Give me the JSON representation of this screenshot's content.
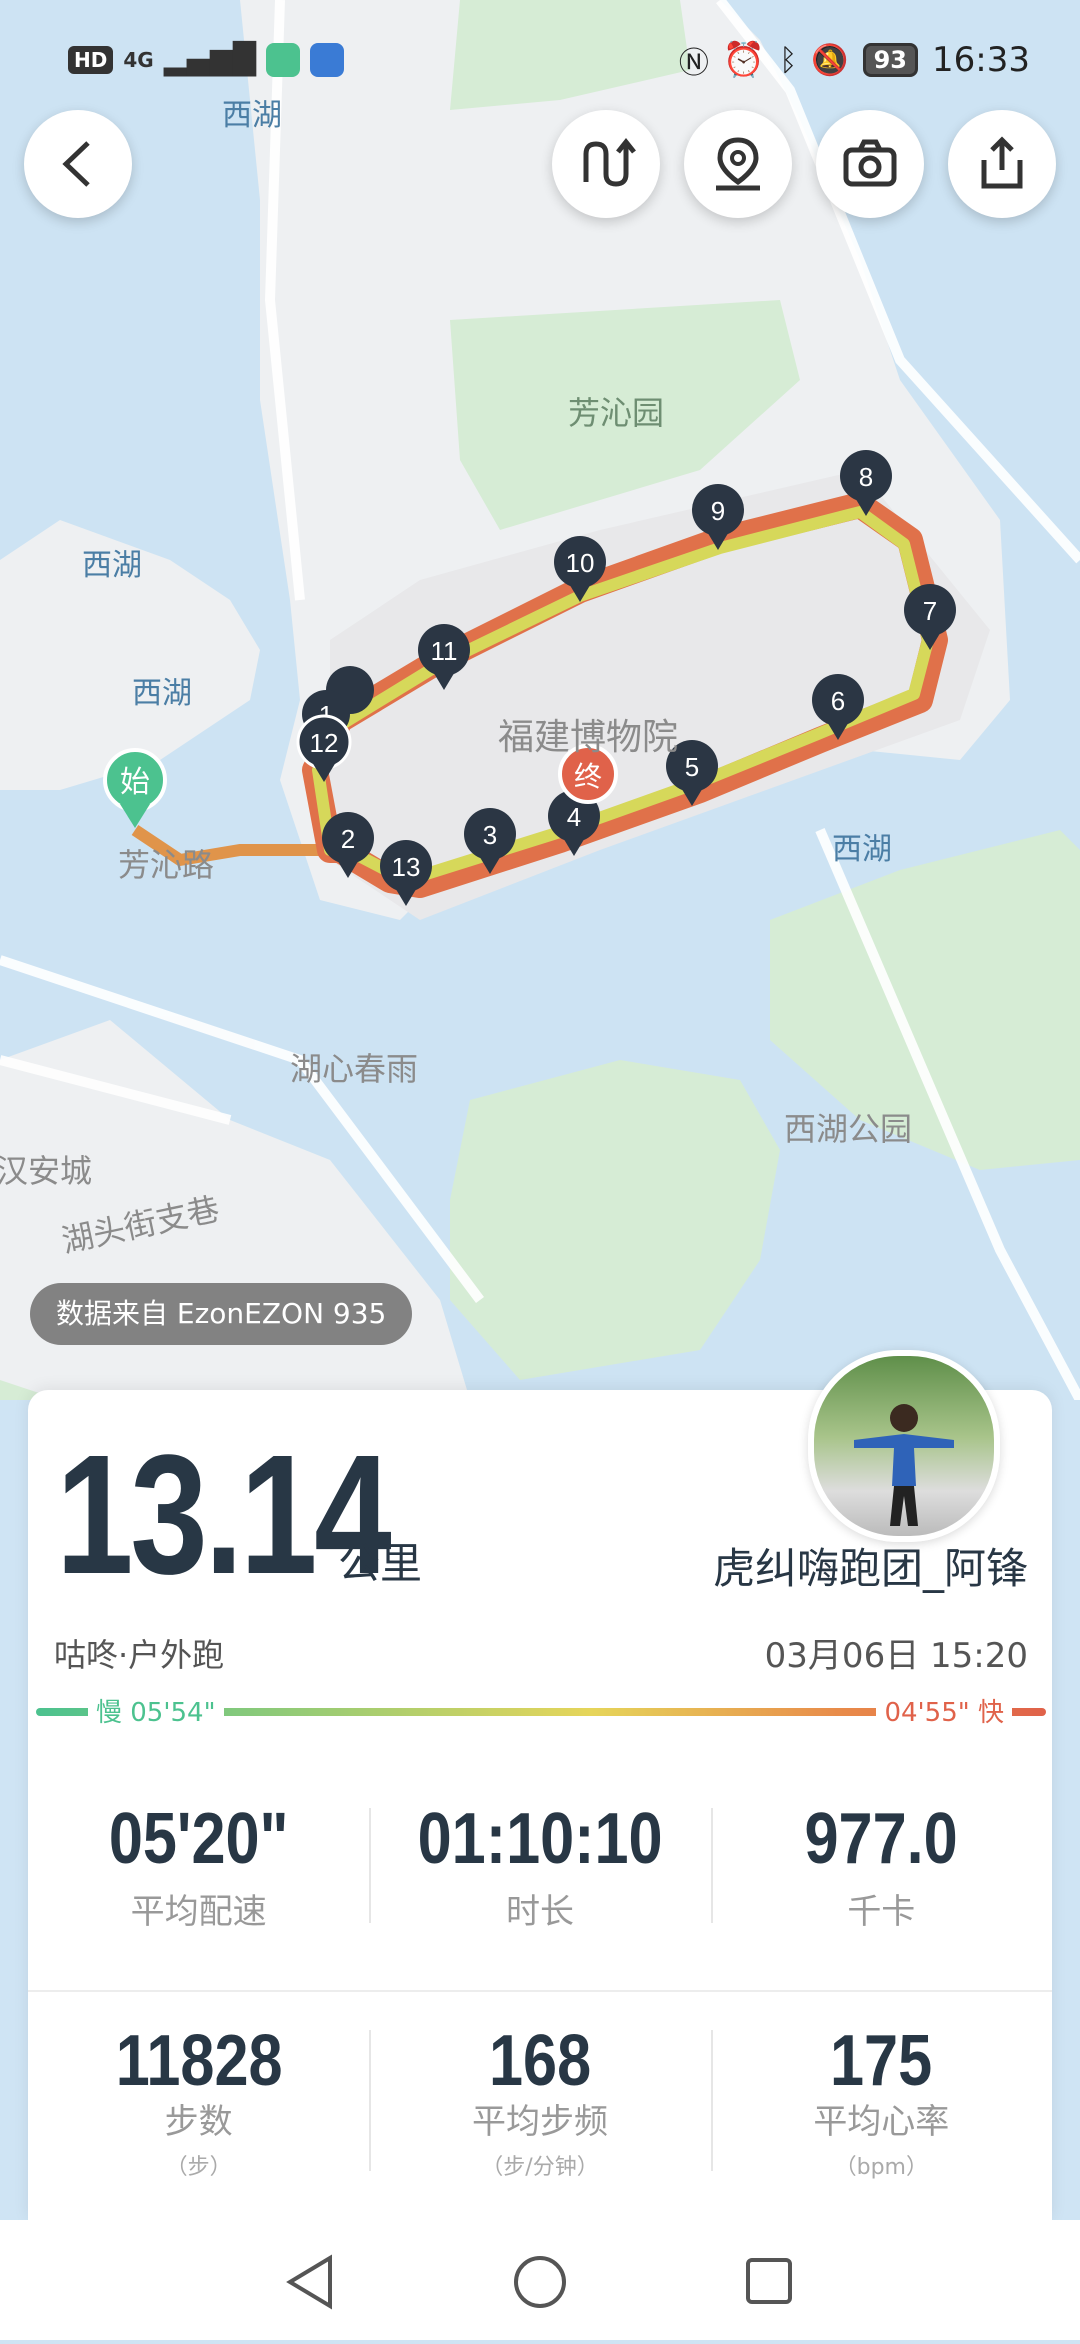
{
  "status_bar": {
    "chips": [
      "HD",
      "4G"
    ],
    "time": "16:33",
    "battery": "93",
    "icons": [
      "nfc-icon",
      "alarm-icon",
      "bluetooth-icon",
      "mute-icon"
    ]
  },
  "map": {
    "labels": {
      "west_lake_top": "西湖",
      "west_lake_left1": "西湖",
      "west_lake_left2": "西湖",
      "west_lake_right": "西湖",
      "fangqin_garden": "芳沁园",
      "museum": "福建博物院",
      "fangqin_road": "芳沁路",
      "lake_heart_spring_rain": "湖心春雨",
      "west_lake_park": "西湖公园",
      "hantou_street": "湖头街支巷",
      "anan_city": "汉安城"
    },
    "start_marker": "始",
    "end_marker": "终",
    "km_markers": [
      "1",
      "2",
      "3",
      "4",
      "5",
      "6",
      "7",
      "8",
      "9",
      "10",
      "11",
      "12",
      "13"
    ],
    "data_source": "数据来自 EzonEZON 935"
  },
  "summary": {
    "distance": "13.14",
    "unit": "公里",
    "username": "虎纠嗨跑团_阿锋",
    "activity_type": "咕咚·户外跑",
    "datetime": "03月06日 15:20",
    "pace_slow": "慢 05'54\"",
    "pace_fast": "04'55\" 快",
    "stats_row1": [
      {
        "value": "05'20\"",
        "label": "平均配速"
      },
      {
        "value": "01:10:10",
        "label": "时长"
      },
      {
        "value": "977.0",
        "label": "千卡"
      }
    ],
    "stats_row2": [
      {
        "value": "11828",
        "label": "步数",
        "sub": "（步）"
      },
      {
        "value": "168",
        "label": "平均步频",
        "sub": "（步/分钟）"
      },
      {
        "value": "175",
        "label": "平均心率",
        "sub": "（bpm）"
      }
    ]
  },
  "colors": {
    "route_outer": "#e0714a",
    "route_inner": "#d6d85a",
    "marker": "#2b3644",
    "start": "#4cc28f",
    "end": "#e0624a"
  }
}
